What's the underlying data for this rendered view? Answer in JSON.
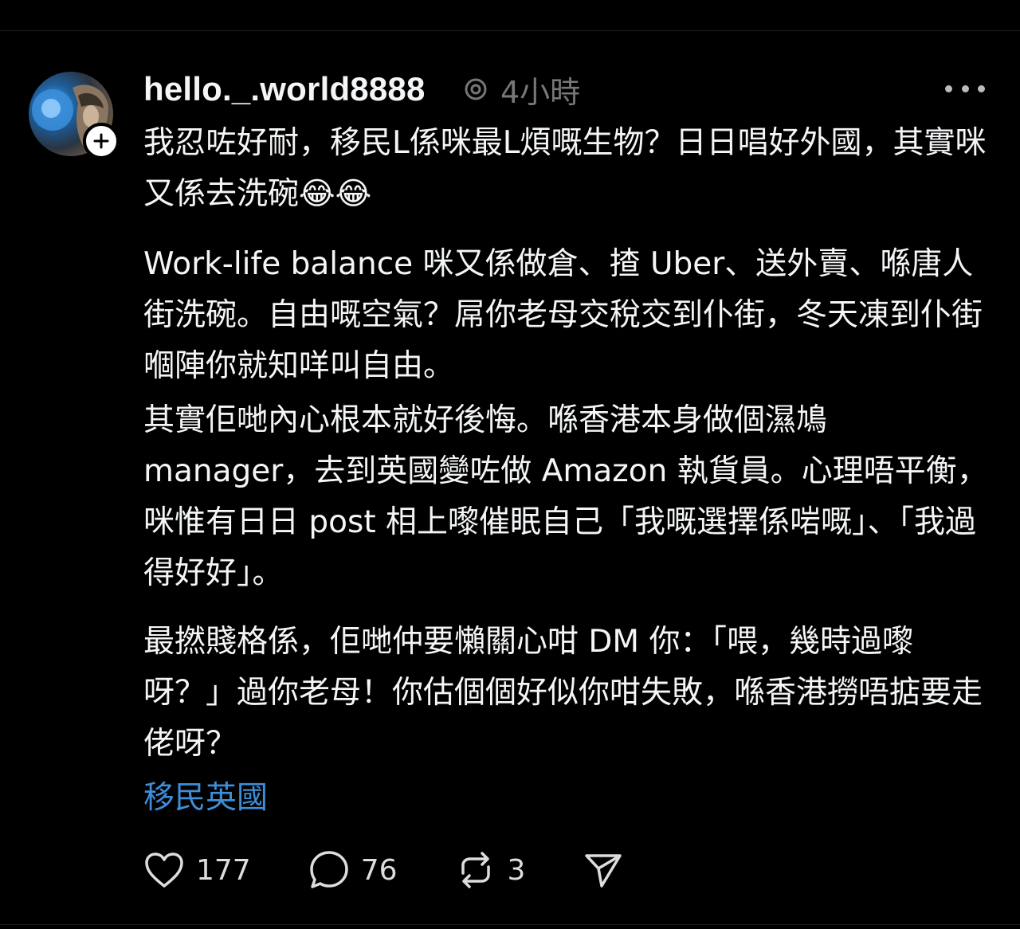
{
  "post": {
    "username": "hello._.world8888",
    "time": "4小時",
    "paragraphs": [
      "我忍咗好耐，移民L係咪最L煩嘅生物？日日唱好外國，其實咪又係去洗碗😂😂",
      "Work-life balance 咪又係做倉、揸 Uber、送外賣、喺唐人街洗碗。自由嘅空氣？屌你老母交稅交到仆街，冬天凍到仆街嗰陣你就知咩叫自由。",
      "其實佢哋內心根本就好後悔。喺香港本身做個濕鳩 manager，去到英國變咗做 Amazon 執貨員。心理唔平衡，咪惟有日日 post 相上嚟催眠自己「我嘅選擇係啱嘅」、「我過得好好」。",
      "最撚賤格係，佢哋仲要懶關心咁 DM 你：「喂，幾時過嚟呀？」過你老母！你估個個好似你咁失敗，喺香港撈唔掂要走佬呀？"
    ],
    "tag": "移民英國",
    "actions": {
      "likes": "177",
      "replies": "76",
      "reposts": "3"
    }
  },
  "icons": {
    "follow": "plus-icon",
    "threads": "threads-logo-icon",
    "more": "more-dots-icon",
    "like": "heart-icon",
    "reply": "comment-icon",
    "repost": "repost-icon",
    "share": "send-icon"
  },
  "colors": {
    "background": "#000000",
    "text": "#f3f5f7",
    "muted": "#777777",
    "tag": "#3e8ed8"
  }
}
